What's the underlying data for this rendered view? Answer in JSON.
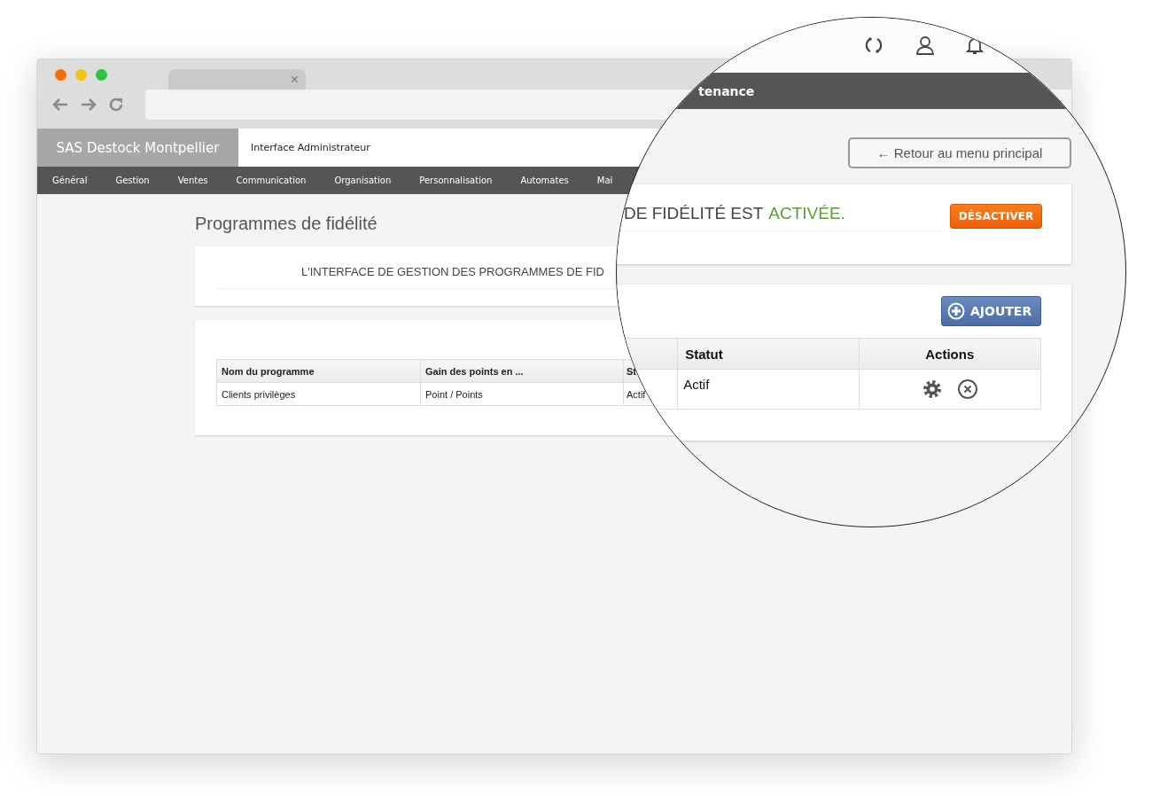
{
  "browser": {
    "tab_close": "×"
  },
  "app": {
    "brand": "SAS Destock Montpellier",
    "subtitle": "Interface Administrateur",
    "nav": [
      "Général",
      "Gestion",
      "Ventes",
      "Communication",
      "Organisation",
      "Personnalisation",
      "Automates",
      "Mai"
    ]
  },
  "page": {
    "title": "Programmes de fidélité",
    "notice": "L'INTERFACE DE GESTION DES PROGRAMMES DE FID",
    "table": {
      "columns": [
        "Nom du programme",
        "Gain des points en ...",
        "St"
      ],
      "rows": [
        [
          "Clients privilèges",
          "Point / Points",
          "Actif"
        ]
      ]
    }
  },
  "magnifier": {
    "nav_item": "tenance",
    "back_button": "← Retour au menu principal",
    "status_text": "DE FIDÉLITÉ EST",
    "status_value": "ACTIVÉE.",
    "toggle_button": "DÉSACTIVER",
    "add_button": "AJOUTER",
    "table": {
      "columns": [
        "Statut",
        "Actions"
      ],
      "rows": [
        {
          "status": "Actif"
        }
      ]
    }
  }
}
